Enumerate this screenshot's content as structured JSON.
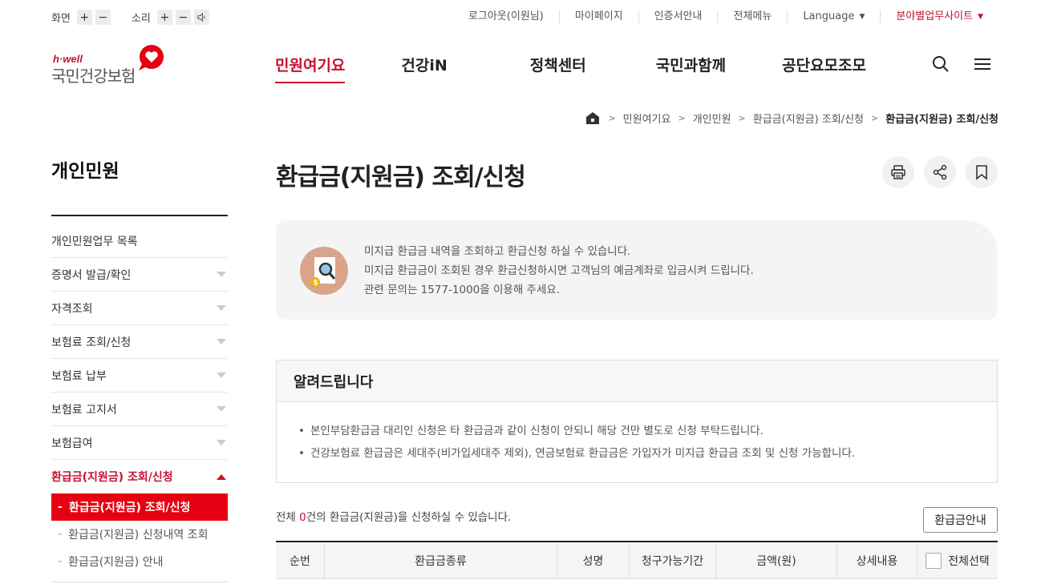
{
  "utility": {
    "font_size_label": "화면",
    "sound_label": "소리",
    "plus": "+",
    "minus": "−",
    "links": [
      "로그아웃(이원님)",
      "마이페이지",
      "인증서안내",
      "전체메뉴",
      "Language",
      "분야별업무사이트"
    ]
  },
  "logo": {
    "brand": "h·well",
    "name": "국민건강보험"
  },
  "gnb": [
    "민원여기요",
    "건강iN",
    "정책센터",
    "국민과함께",
    "공단요모조모"
  ],
  "breadcrumb": [
    "민원여기요",
    "개인민원",
    "환급금(지원금) 조회/신청",
    "환급금(지원금) 조회/신청"
  ],
  "sidebar": {
    "title": "개인민원",
    "items": [
      "개인민원업무 목록",
      "증명서 발급/확인",
      "자격조회",
      "보험료 조회/신청",
      "보험료 납부",
      "보험료 고지서",
      "보험급여",
      "환급금(지원금) 조회/신청"
    ],
    "sub_items": [
      "환급금(지원금) 조회/신청",
      "환급금(지원금) 신청내역 조회",
      "환급금(지원금) 안내"
    ]
  },
  "page": {
    "title": "환급금(지원금) 조회/신청",
    "info_lines": [
      "미지급 환급금 내역을 조회하고 환급신청 하실 수 있습니다.",
      "미지급 환급금이 조회된 경우 환급신청하시면 고객님의 예금계좌로 입금시켜 드립니다.",
      "관련 문의는 1577-1000을 이용해 주세요."
    ],
    "notice_title": "알려드립니다",
    "notice_items": [
      "본인부담환급금 대리인 신청은 타 환급금과 같이 신청이 안되니 해당 건만 별도로 신청 부탁드립니다.",
      "건강보험료 환급금은 세대주(비가입세대주 제외), 연금보험료 환급금은 가입자가 미지급 환급금 조회 및 신청 가능합니다."
    ],
    "summary_prefix": "전체 ",
    "summary_count": "0",
    "summary_suffix": "건의 환급금(지원금)을 신청하실 수 있습니다.",
    "guide_button": "환급금안내",
    "columns": [
      "순번",
      "환급금종류",
      "성명",
      "청구가능기간",
      "금액(원)",
      "상세내용",
      "전체선택"
    ]
  },
  "colors": {
    "accent": "#c8102e",
    "active_bg": "#e60012"
  }
}
